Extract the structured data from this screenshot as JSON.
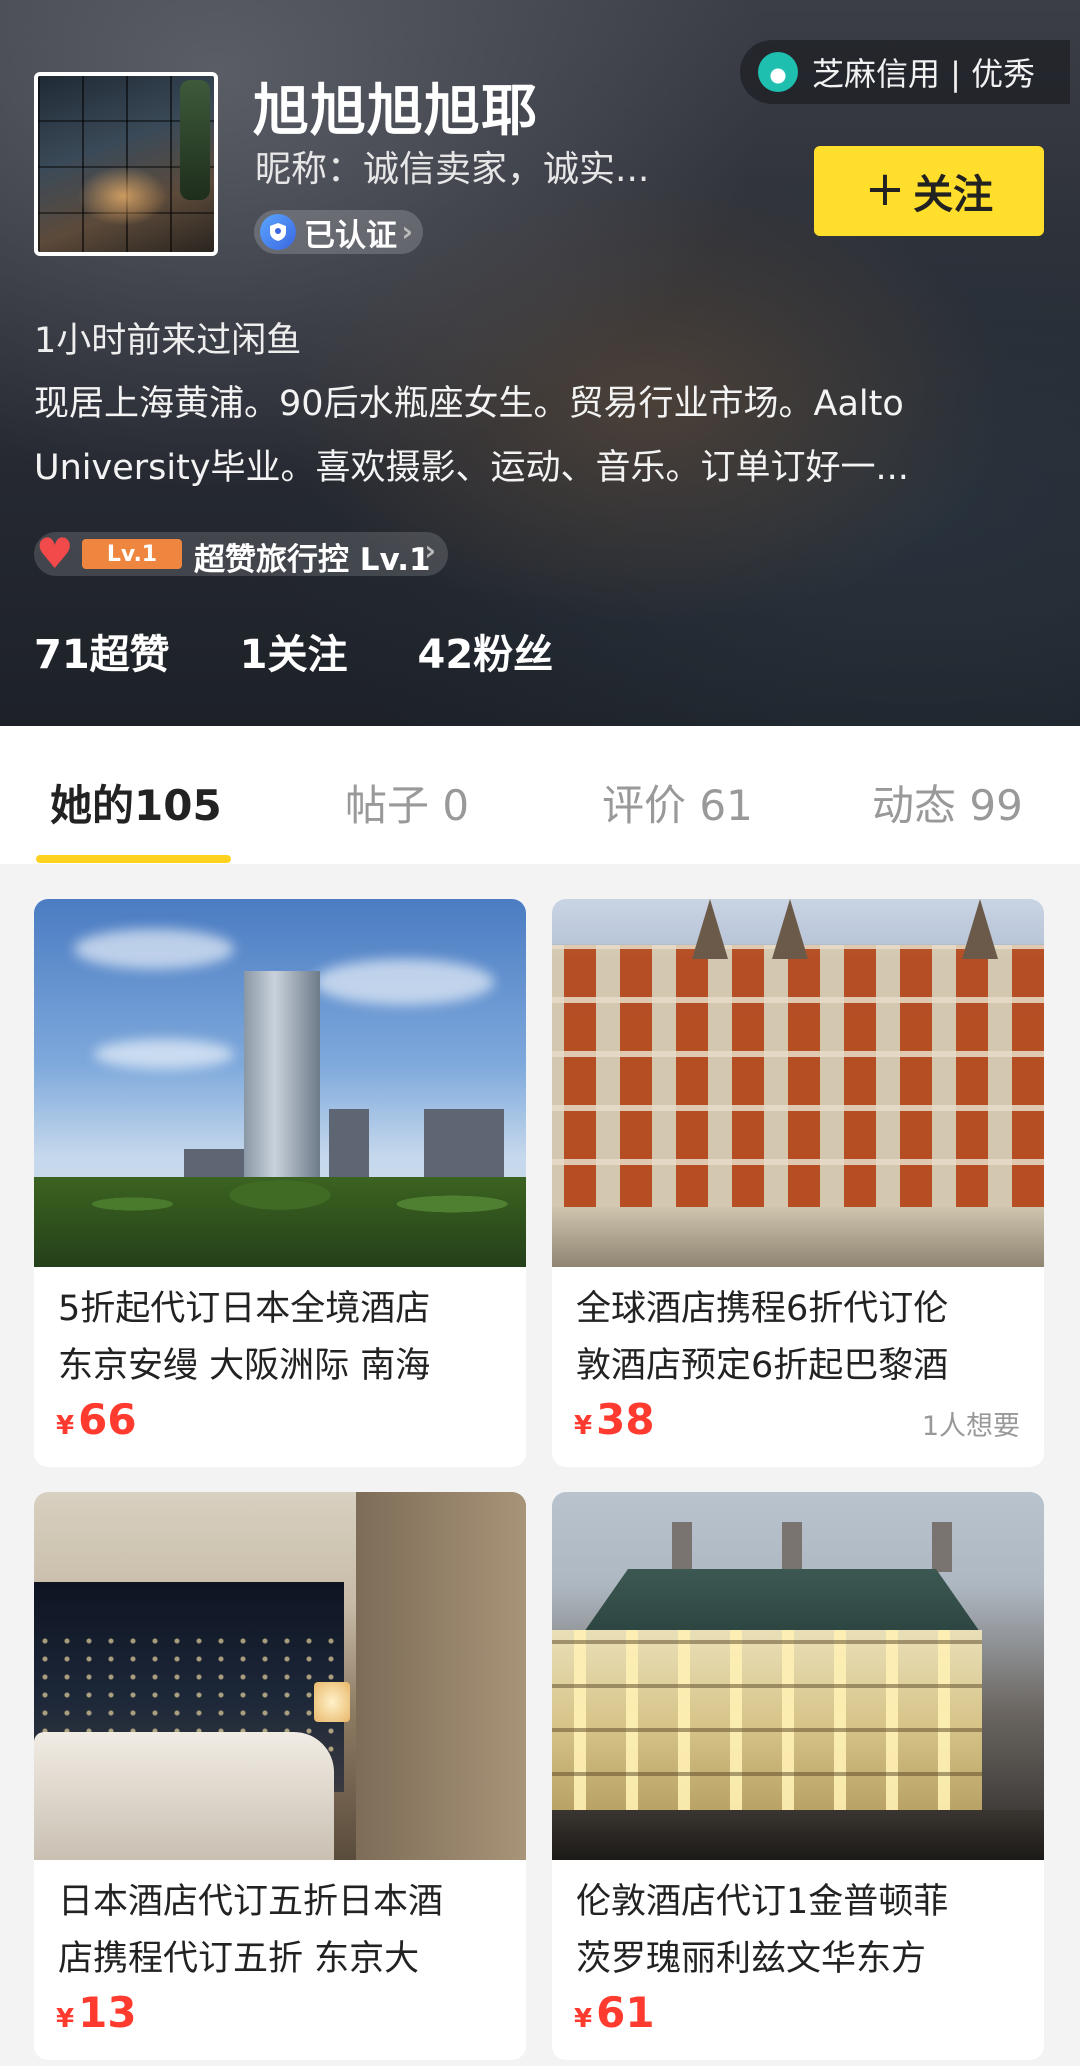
{
  "profile": {
    "name": "旭旭旭旭耶",
    "nickname": "昵称：诚信卖家，诚实...",
    "verified_label": "已认证",
    "sesame_credit": "芝麻信用 | 优秀",
    "follow_label": "关注",
    "last_seen": "1小时前来过闲鱼",
    "bio_line1": "现居上海黄浦。90后水瓶座女生。贸易行业市场。Aalto",
    "bio_line2": "University毕业。喜欢摄影、运动、音乐。订单订好一...",
    "level_tag": "Lv.1",
    "level_text": "超赞旅行控 Lv.1",
    "stats": [
      {
        "label": "71超赞"
      },
      {
        "label": "1关注"
      },
      {
        "label": "42粉丝"
      }
    ]
  },
  "tabs": [
    {
      "label": "她的105",
      "active": true
    },
    {
      "label": "帖子 0",
      "active": false
    },
    {
      "label": "评价 61",
      "active": false
    },
    {
      "label": "动态 99",
      "active": false
    }
  ],
  "items": [
    {
      "title_line1": "5折起代订日本全境酒店",
      "title_line2": "东京安缦 大阪洲际 南海",
      "currency": "¥",
      "price": "66",
      "wants": ""
    },
    {
      "title_line1": "全球酒店携程6折代订伦",
      "title_line2": "敦酒店预定6折起巴黎酒",
      "currency": "¥",
      "price": "38",
      "wants": "1人想要"
    },
    {
      "title_line1": "日本酒店代订五折日本酒",
      "title_line2": "店携程代订五折 东京大",
      "currency": "¥",
      "price": "13",
      "wants": ""
    },
    {
      "title_line1": "伦敦酒店代订1金普顿菲",
      "title_line2": "茨罗瑰丽利兹文华东方",
      "currency": "¥",
      "price": "61",
      "wants": ""
    }
  ],
  "colors": {
    "accent_yellow": "#ffdf2b",
    "price_red": "#ff3b30"
  }
}
